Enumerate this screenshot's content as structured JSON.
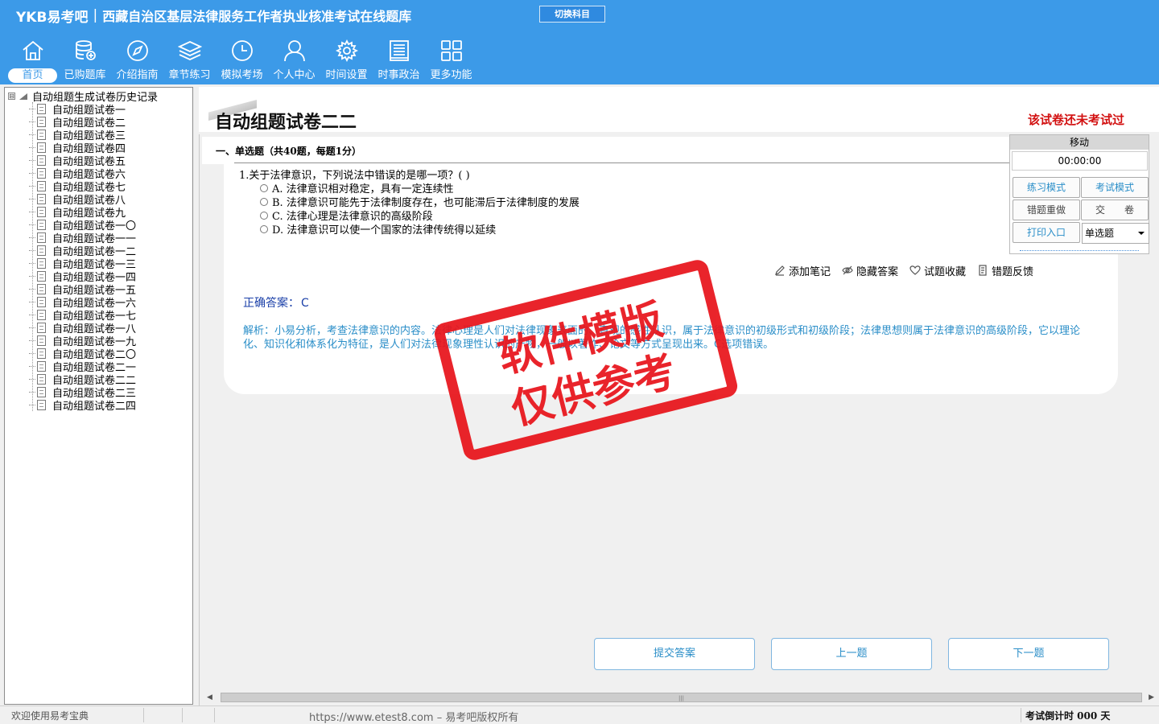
{
  "header": {
    "logo": "YKB易考吧",
    "separator": "|",
    "app_title": "西藏自治区基层法律服务工作者执业核准考试在线题库",
    "switch_subject": "切换科目",
    "nav": [
      {
        "label": "首页",
        "icon": "home-icon"
      },
      {
        "label": "已购题库",
        "icon": "database-icon"
      },
      {
        "label": "介绍指南",
        "icon": "compass-icon"
      },
      {
        "label": "章节练习",
        "icon": "layers-icon"
      },
      {
        "label": "模拟考场",
        "icon": "clock-icon"
      },
      {
        "label": "个人中心",
        "icon": "user-icon"
      },
      {
        "label": "时间设置",
        "icon": "gear-icon"
      },
      {
        "label": "时事政治",
        "icon": "news-icon"
      },
      {
        "label": "更多功能",
        "icon": "grid-icon"
      }
    ]
  },
  "sidebar": {
    "expander": "⊟",
    "root_label": "自动组题生成试卷历史记录",
    "items": [
      "自动组题试卷一",
      "自动组题试卷二",
      "自动组题试卷三",
      "自动组题试卷四",
      "自动组题试卷五",
      "自动组题试卷六",
      "自动组题试卷七",
      "自动组题试卷八",
      "自动组题试卷九",
      "自动组题试卷一〇",
      "自动组题试卷一一",
      "自动组题试卷一二",
      "自动组题试卷一三",
      "自动组题试卷一四",
      "自动组题试卷一五",
      "自动组题试卷一六",
      "自动组题试卷一七",
      "自动组题试卷一八",
      "自动组题试卷一九",
      "自动组题试卷二〇",
      "自动组题试卷二一",
      "自动组题试卷二二",
      "自动组题试卷二三",
      "自动组题试卷二四"
    ]
  },
  "main": {
    "paper_title": "自动组题试卷二二",
    "exam_status": "该试卷还未考试过",
    "section_title": "一、单选题（共40题，每题1分）",
    "question": {
      "stem": "1.关于法律意识，下列说法中错误的是哪一项？( )",
      "options": [
        "A. 法律意识相对稳定，具有一定连续性",
        "B. 法律意识可能先于法律制度存在，也可能滞后于法律制度的发展",
        "C. 法律心理是法律意识的高级阶段",
        "D. 法律意识可以使一个国家的法律传统得以延续"
      ],
      "tools": [
        {
          "label": "添加笔记",
          "icon": "pencil-icon"
        },
        {
          "label": "隐藏答案",
          "icon": "eye-icon"
        },
        {
          "label": "试题收藏",
          "icon": "heart-icon"
        },
        {
          "label": "错题反馈",
          "icon": "feedback-icon"
        }
      ],
      "answer_label": "正确答案：",
      "answer_value": "C",
      "explanation": "解析：小易分析，考查法律意识的内容。法律心理是人们对法律现象表面的、直观的感性认识，属于法律意识的初级形式和初级阶段；法律思想则属于法律意识的高级阶段，它以理论化、知识化和体系化为特征，是人们对法律现象理性认识的产物，一般以著作、论文等方式呈现出来。C选项错误。"
    },
    "buttons": {
      "submit": "提交答案",
      "prev": "上一题",
      "next": "下一题"
    }
  },
  "control_panel": {
    "move": "移动",
    "timer": "00:00:00",
    "practice_mode": "练习模式",
    "exam_mode": "考试模式",
    "redo_wrong": "错题重做",
    "hand_in": "交　　卷",
    "print": "打印入口",
    "question_type": "单选题"
  },
  "statusbar": {
    "welcome": "欢迎使用易考宝典",
    "url": "https://www.etest8.com – 易考吧版权所有",
    "countdown": "考试倒计时 000 天"
  },
  "watermark": {
    "line1": "软件模版",
    "line2": "仅供参考"
  },
  "colors": {
    "header_bg": "#3c9ae8",
    "status_red": "#d21010",
    "answer_blue": "#1a3fa8",
    "explain_blue": "#2a8ec8",
    "stamp_red": "#e8141b"
  }
}
